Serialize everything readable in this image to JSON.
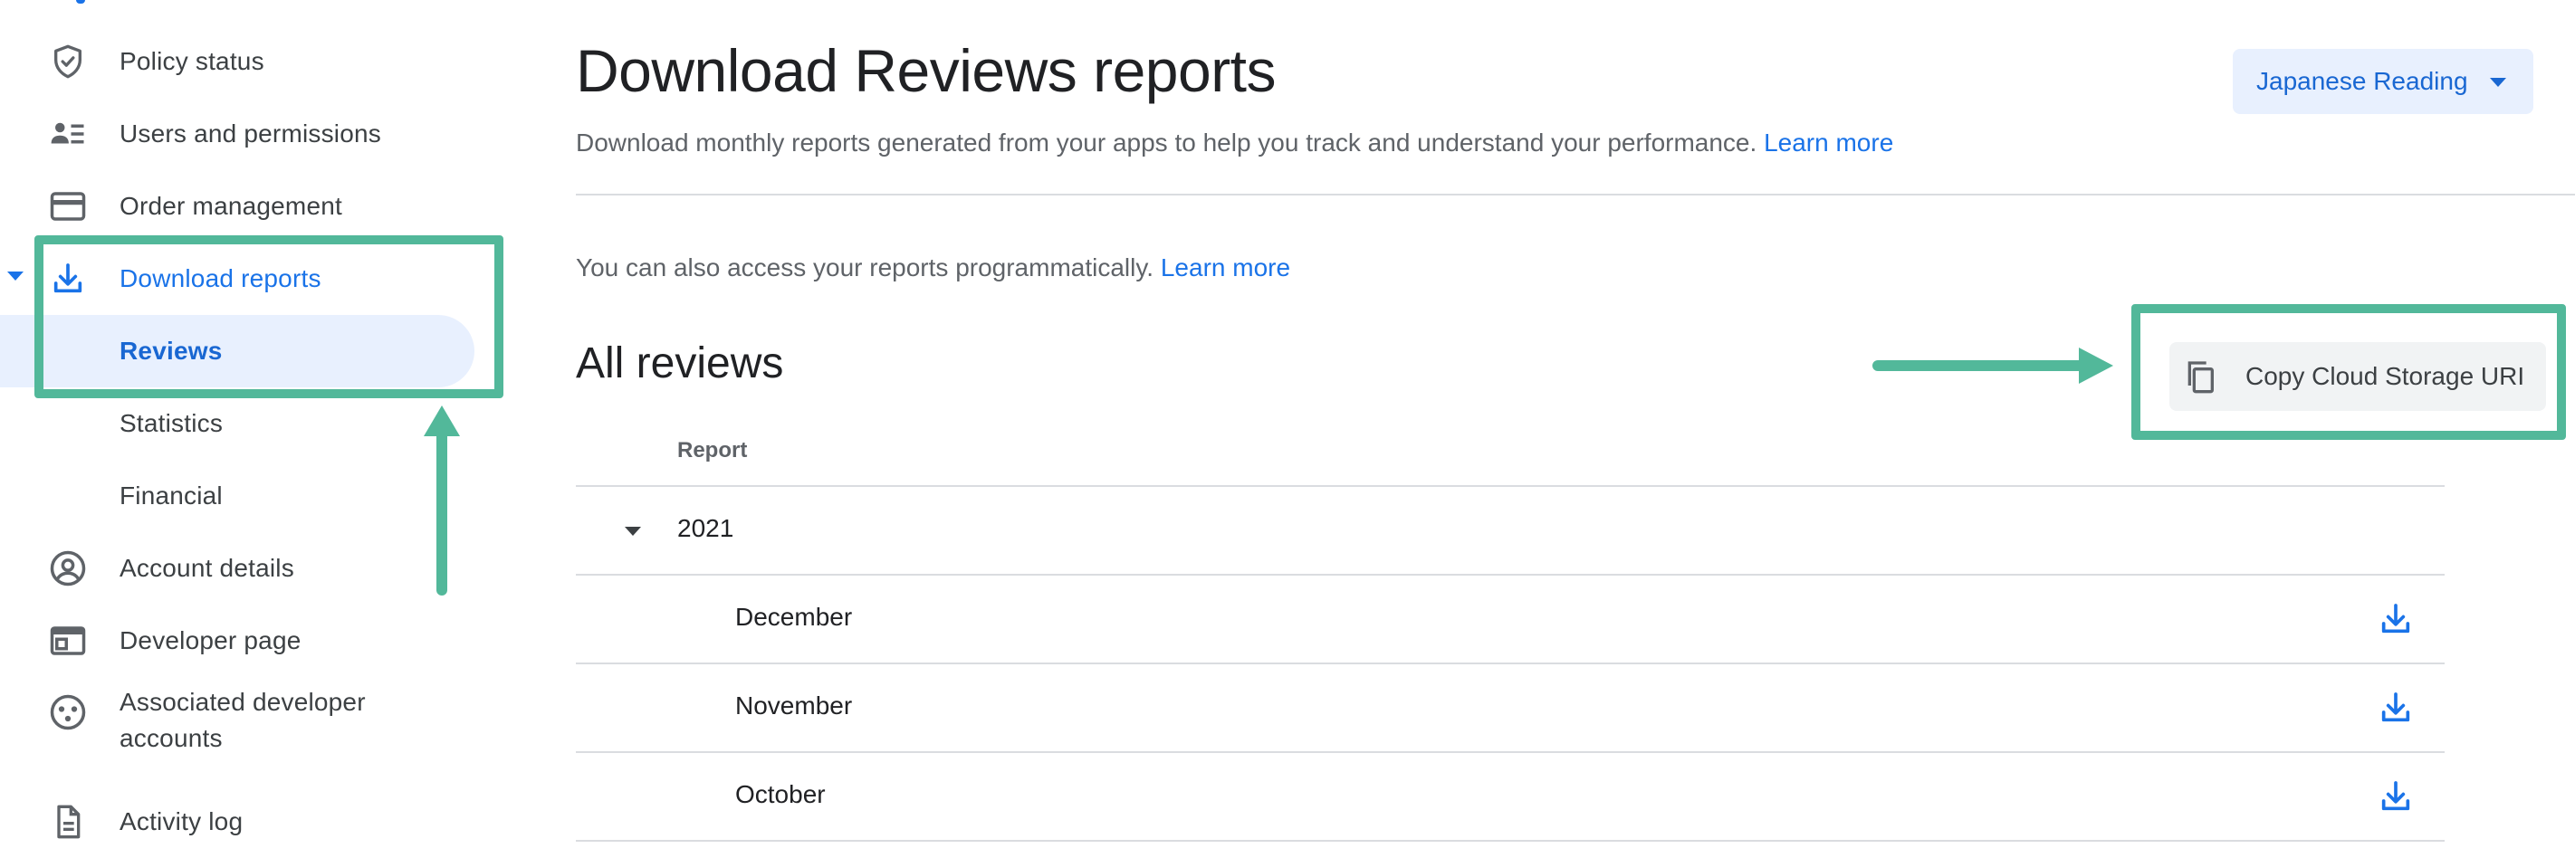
{
  "sidebar": {
    "items": [
      {
        "label": "Policy status",
        "icon": "shield-check-icon"
      },
      {
        "label": "Users and permissions",
        "icon": "users-list-icon"
      },
      {
        "label": "Order management",
        "icon": "credit-card-icon"
      },
      {
        "label": "Download reports",
        "icon": "download-icon"
      },
      {
        "label": "Reviews"
      },
      {
        "label": "Statistics"
      },
      {
        "label": "Financial"
      },
      {
        "label": "Account details",
        "icon": "account-circle-icon"
      },
      {
        "label": "Developer page",
        "icon": "web-page-icon"
      },
      {
        "label": "Associated developer accounts",
        "icon": "linked-accounts-icon"
      },
      {
        "label": "Activity log",
        "icon": "document-icon"
      }
    ]
  },
  "header": {
    "title": "Download Reviews reports",
    "subtitle": "Download monthly reports generated from your apps to help you track and understand your performance.",
    "subtitle_link": "Learn more",
    "app_selector": "Japanese Reading"
  },
  "programmatic": {
    "text": "You can also access your reports programmatically.",
    "link": "Learn more"
  },
  "reviews": {
    "title": "All reviews",
    "copy_button": "Copy Cloud Storage URI",
    "column_header": "Report",
    "year": "2021",
    "months": [
      "December",
      "November",
      "October"
    ]
  },
  "colors": {
    "accent": "#1a73e8",
    "highlight": "#52b89a",
    "selected_bg": "#e8f0fe"
  }
}
